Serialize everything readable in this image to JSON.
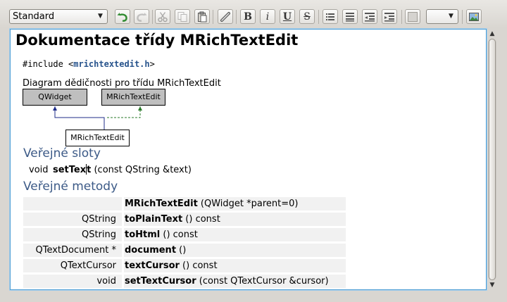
{
  "toolbar": {
    "style_select": "Standard",
    "color_select": "",
    "buttons": [
      {
        "name": "undo-icon",
        "enabled": true
      },
      {
        "name": "redo-icon",
        "enabled": false
      },
      {
        "name": "cut-icon",
        "enabled": false
      },
      {
        "name": "copy-icon",
        "enabled": false
      },
      {
        "name": "paste-icon",
        "enabled": true
      },
      {
        "name": "link-icon",
        "enabled": true
      },
      {
        "name": "bold-icon",
        "enabled": true
      },
      {
        "name": "italic-icon",
        "enabled": true
      },
      {
        "name": "underline-icon",
        "enabled": true
      },
      {
        "name": "strikethrough-icon",
        "enabled": true
      },
      {
        "name": "bullet-list-icon",
        "enabled": true
      },
      {
        "name": "numbered-list-icon",
        "enabled": true
      },
      {
        "name": "outdent-icon",
        "enabled": true
      },
      {
        "name": "indent-icon",
        "enabled": true
      },
      {
        "name": "text-color-icon",
        "enabled": true
      },
      {
        "name": "insert-image-icon",
        "enabled": true
      }
    ],
    "bold_glyph": "B",
    "italic_glyph": "i",
    "underline_glyph": "U",
    "strike_glyph": "S"
  },
  "document": {
    "title": "Dokumentace třídy MRichTextEdit",
    "include_prefix": "#include <",
    "include_file": "mrichtextedit.h",
    "include_suffix": ">",
    "diagram_caption": "Diagram dědičnosti pro třídu MRichTextEdit",
    "diagram": {
      "parent_left": "QWidget",
      "parent_right": "MRichTextEdit",
      "child": "MRichTextEdit"
    },
    "slots_title": "Veřejné sloty",
    "slot": {
      "return": "void",
      "name_before_caret": "setTex",
      "name_after_caret": "t",
      "args": " (const QString &text)"
    },
    "methods_title": "Veřejné metody",
    "methods": [
      {
        "return": "",
        "name": "MRichTextEdit",
        "args": " (QWidget *parent=0)"
      },
      {
        "return": "QString",
        "name": "toPlainText",
        "args": " () const"
      },
      {
        "return": "QString",
        "name": "toHtml",
        "args": " () const"
      },
      {
        "return": "QTextDocument *",
        "name": "document",
        "args": " ()"
      },
      {
        "return": "QTextCursor",
        "name": "textCursor",
        "args": " () const"
      },
      {
        "return": "void",
        "name": "setTextCursor",
        "args": " (const QTextCursor &cursor)"
      }
    ]
  },
  "colors": {
    "section_title": "#3c5a87",
    "include_link": "#27538c",
    "editor_border": "#4e9ed4",
    "arrow_navy": "#1f2d8a",
    "arrow_green": "#2a7a2a"
  }
}
